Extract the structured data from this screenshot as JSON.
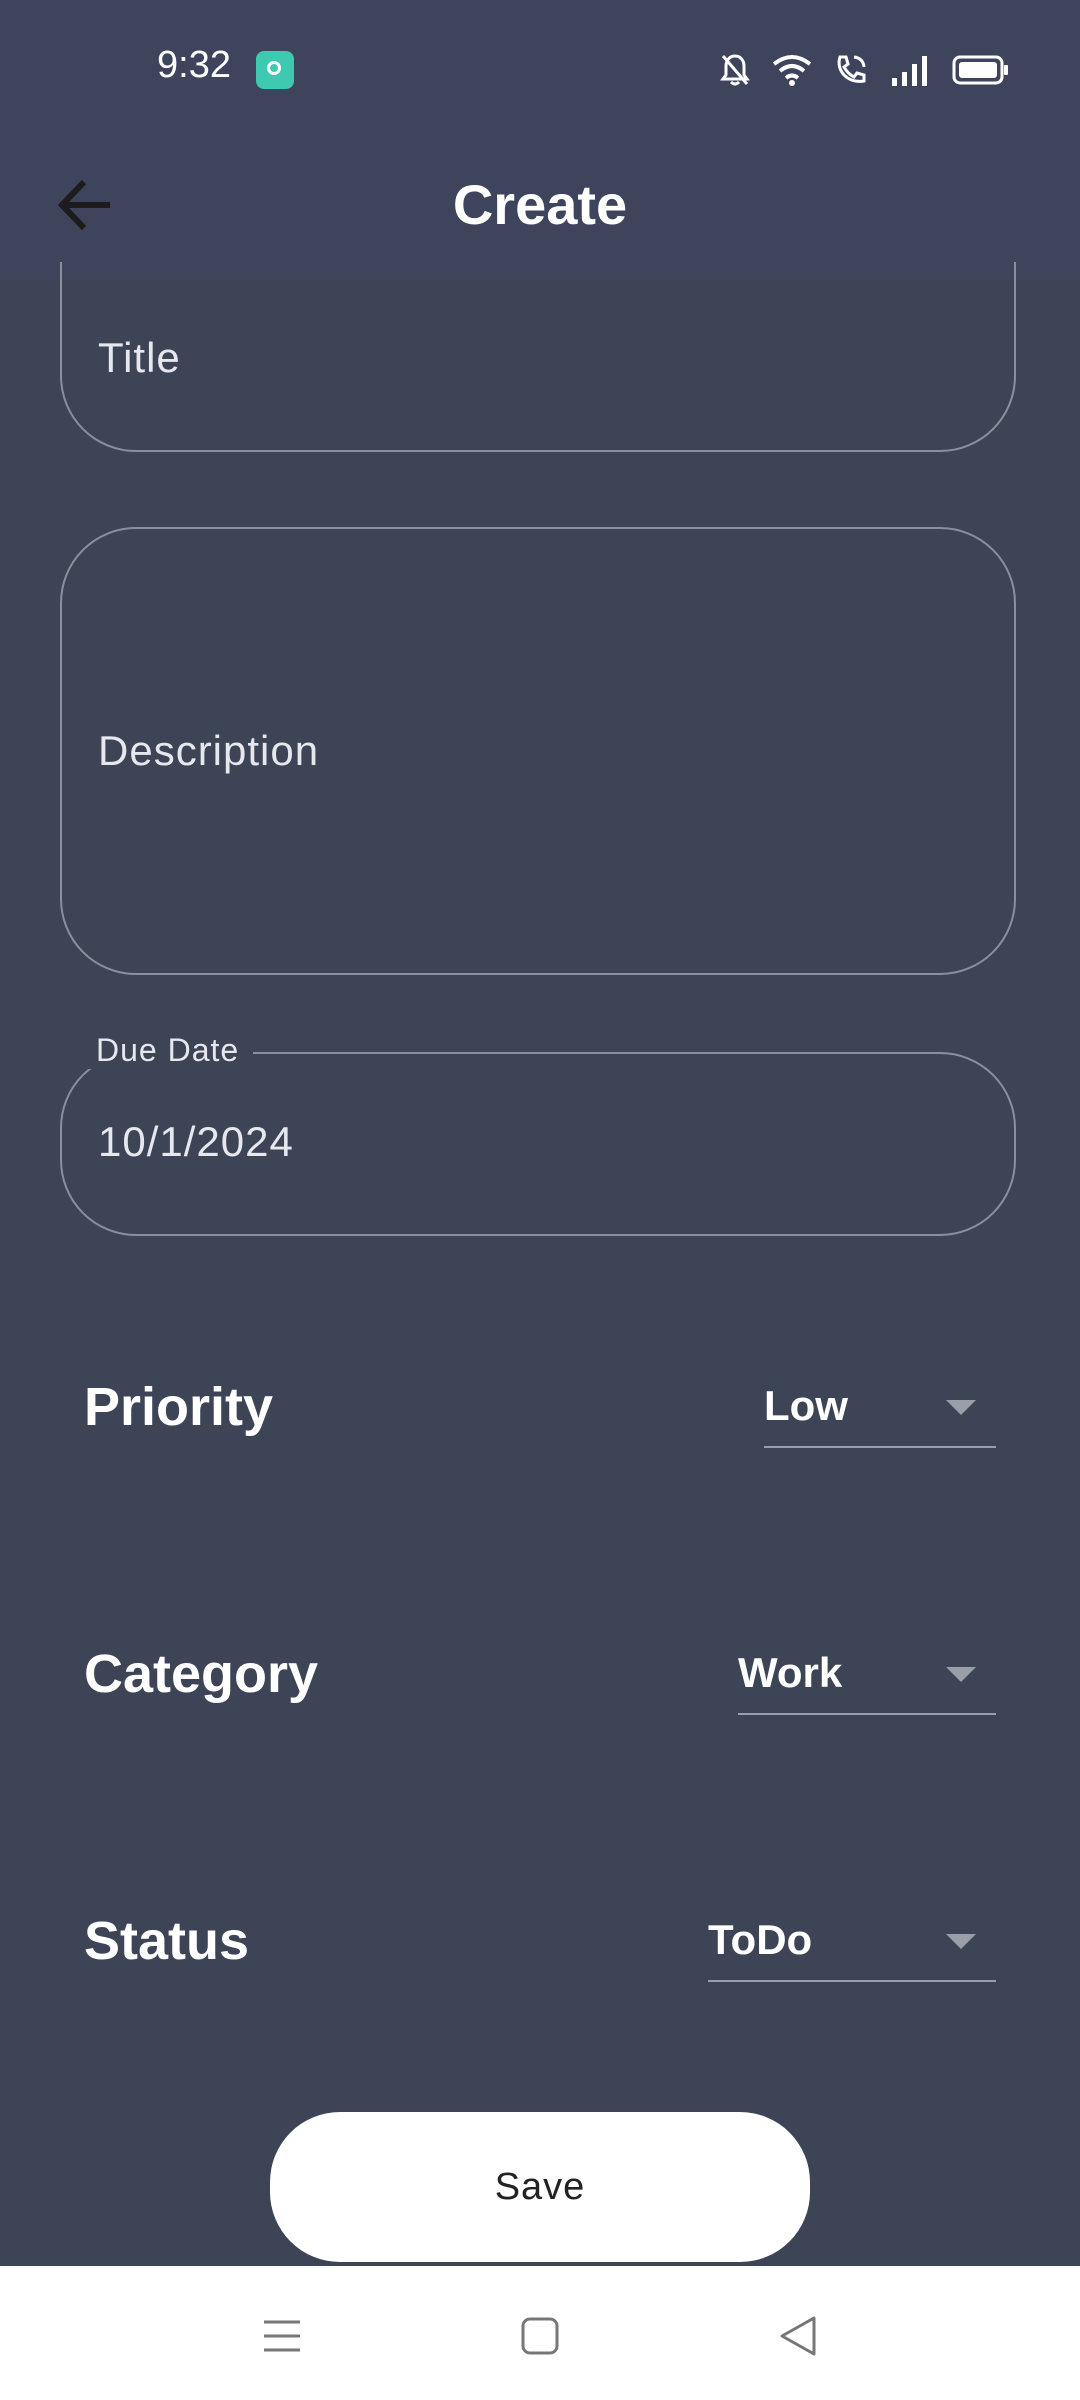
{
  "status_bar": {
    "time": "9:32",
    "icons": [
      "app-notification-icon",
      "bell-muted-icon",
      "wifi-icon",
      "wifi-calling-icon",
      "signal-icon",
      "battery-icon"
    ]
  },
  "app_bar": {
    "title": "Create",
    "back_icon": "arrow-left-icon"
  },
  "form": {
    "title_placeholder": "Title",
    "description_placeholder": "Description",
    "due_date_label": "Due Date",
    "due_date_value": "10/1/2024",
    "priority": {
      "label": "Priority",
      "value": "Low"
    },
    "category": {
      "label": "Category",
      "value": "Work"
    },
    "status": {
      "label": "Status",
      "value": "ToDo"
    },
    "save_label": "Save"
  },
  "nav_bar": {
    "icons": [
      "menu-icon",
      "home-square-icon",
      "back-triangle-icon"
    ]
  },
  "colors": {
    "background": "#3c4456",
    "app_bar": "#3f445d",
    "field_border": "#8a8f9b",
    "button": "#ffffff"
  }
}
